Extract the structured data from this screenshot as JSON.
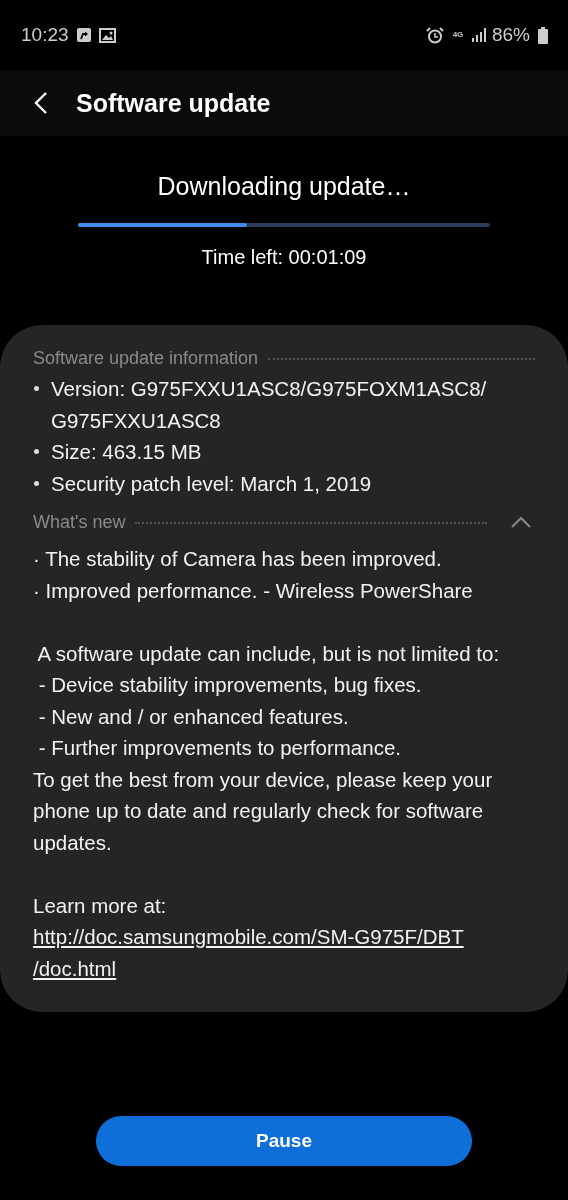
{
  "status_bar": {
    "time": "10:23",
    "network": "4G",
    "battery": "86%"
  },
  "app_bar": {
    "title": "Software update"
  },
  "progress": {
    "title": "Downloading update…",
    "level": 0.41,
    "time_left": "Time left: 00:01:09"
  },
  "info": {
    "heading": "Software update information",
    "items": [
      {
        "lines": [
          "Version: G975FXXU1ASC8/G975FOXM1ASC8/",
          "G975FXXU1ASC8"
        ]
      },
      {
        "lines": [
          "Size: 463.15 MB"
        ]
      },
      {
        "lines": [
          "Security patch level: March 1, 2019"
        ]
      }
    ]
  },
  "whats_new": {
    "heading": "What's new",
    "expanded": true,
    "notes": [
      "· The stability of Camera has been improved.",
      "· Improved performance. - Wireless PowerShare"
    ],
    "description": [
      " A software update can include, but is not limited to:",
      " - Device stability improvements, bug fixes.",
      " - New and / or enhanced features.",
      " - Further improvements to performance.",
      "To get the best from your device, please keep your",
      "phone up to date and regularly check for software",
      "updates."
    ],
    "learn_more": "Learn more at:",
    "link_lines": [
      "http://doc.samsungmobile.com/SM-G975F/DBT",
      "/doc.html"
    ]
  },
  "buttons": [
    {
      "label": "Pause"
    }
  ]
}
